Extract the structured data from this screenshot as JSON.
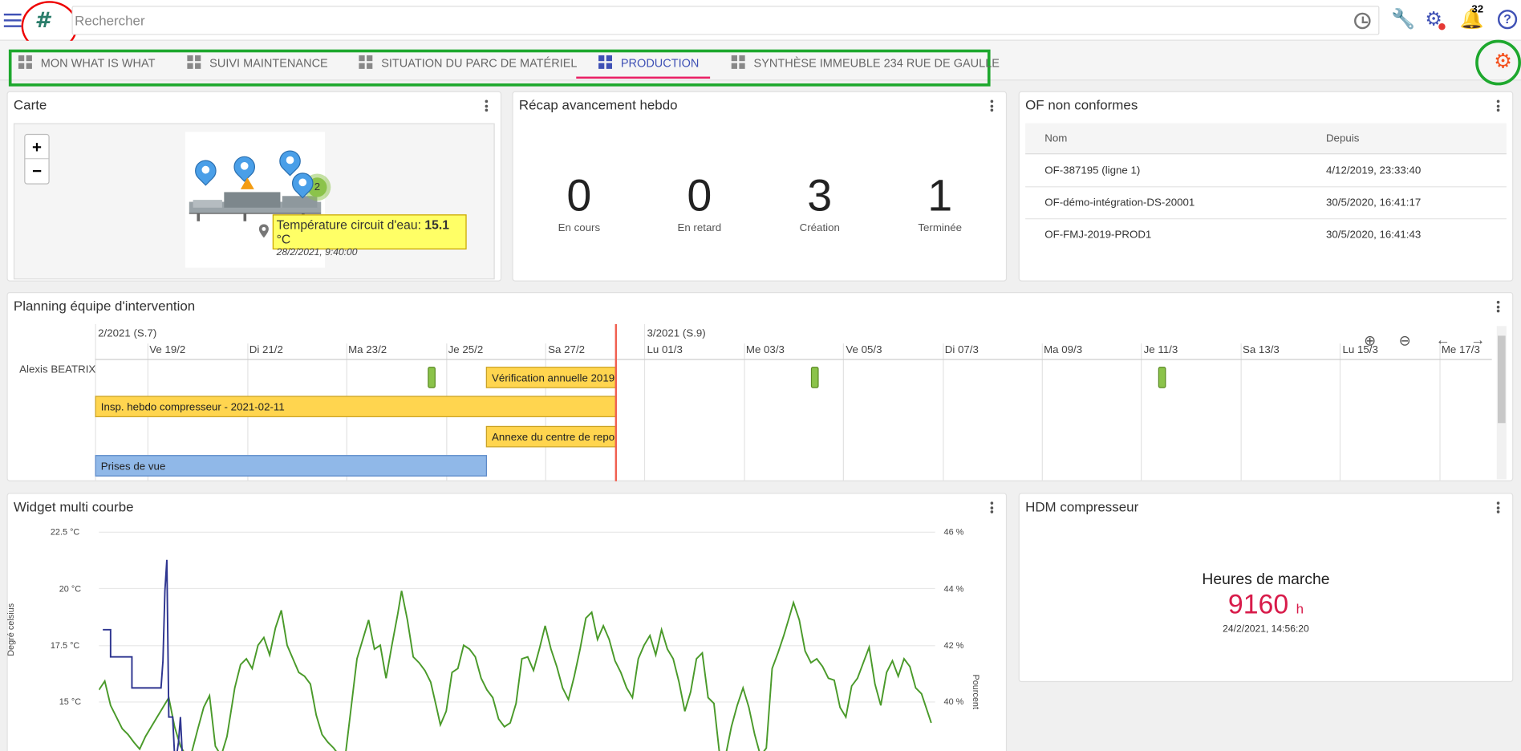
{
  "search": {
    "placeholder": "Rechercher"
  },
  "header": {
    "notification_count": "32",
    "help_label": "?"
  },
  "tabs": [
    {
      "label": "MON WHAT IS WHAT",
      "active": false
    },
    {
      "label": "SUIVI MAINTENANCE",
      "active": false
    },
    {
      "label": "SITUATION DU PARC DE MATÉRIEL",
      "active": false
    },
    {
      "label": "PRODUCTION",
      "active": true
    },
    {
      "label": "SYNTHÈSE IMMEUBLE 234 RUE DE GAULLE",
      "active": false
    }
  ],
  "carte": {
    "title": "Carte",
    "zoom_in": "+",
    "zoom_out": "−",
    "cluster_count": "2",
    "tooltip": {
      "label": "Température circuit d'eau: ",
      "value": "15.1",
      "unit": " °C",
      "date": "28/2/2021, 9:40:00"
    }
  },
  "recap": {
    "title": "Récap avancement hebdo",
    "items": [
      {
        "value": "0",
        "label": "En cours"
      },
      {
        "value": "0",
        "label": "En retard"
      },
      {
        "value": "3",
        "label": "Création"
      },
      {
        "value": "1",
        "label": "Terminée"
      }
    ]
  },
  "of": {
    "title": "OF non conformes",
    "columns": [
      "Nom",
      "Depuis"
    ],
    "rows": [
      [
        "OF-387195 (ligne 1)",
        "4/12/2019, 23:33:40"
      ],
      [
        "OF-démo-intégration-DS-20001",
        "30/5/2020, 16:41:17"
      ],
      [
        "OF-FMJ-2019-PROD1",
        "30/5/2020, 16:41:43"
      ]
    ]
  },
  "planning": {
    "title": "Planning équipe d'intervention",
    "months": [
      "2/2021 (S.7)",
      "3/2021 (S.9)"
    ],
    "days": [
      "Ve 19/2",
      "Di 21/2",
      "Ma 23/2",
      "Je 25/2",
      "Sa 27/2",
      "Lu 01/3",
      "Me 03/3",
      "Ve 05/3",
      "Di 07/3",
      "Ma 09/3",
      "Je 11/3",
      "Sa 13/3",
      "Lu 15/3",
      "Me 17/3"
    ],
    "person": "Alexis BEATRIX",
    "bars": [
      {
        "label": "Vérification annuelle 2019",
        "color": "#ffd54f"
      },
      {
        "label": "Insp. hebdo compresseur - 2021-02-11",
        "color": "#ffd54f"
      },
      {
        "label": "Annexe du centre de repos",
        "color": "#ffd54f"
      },
      {
        "label": "Prises de vue",
        "color": "#90b8e8"
      }
    ]
  },
  "multi_courbe": {
    "title": "Widget multi courbe",
    "left_axis_title": "Degré celsius",
    "right_axis_title": "Pourcent",
    "left_ticks": [
      "22.5 °C",
      "20 °C",
      "17.5 °C",
      "15 °C"
    ],
    "right_ticks": [
      "46 %",
      "44 %",
      "42 %",
      "40 %"
    ],
    "series_colors": [
      "#4a9a2a",
      "#2e3590"
    ]
  },
  "hdm": {
    "title": "HDM compresseur",
    "label": "Heures de marche",
    "value": "9160",
    "unit": "h",
    "date": "24/2/2021, 14:56:20"
  },
  "colors": {
    "accent": "#3f51b5",
    "tab_underline": "#e91e63",
    "highlight_box": "#1ea82e",
    "annotation": "#e00000"
  }
}
